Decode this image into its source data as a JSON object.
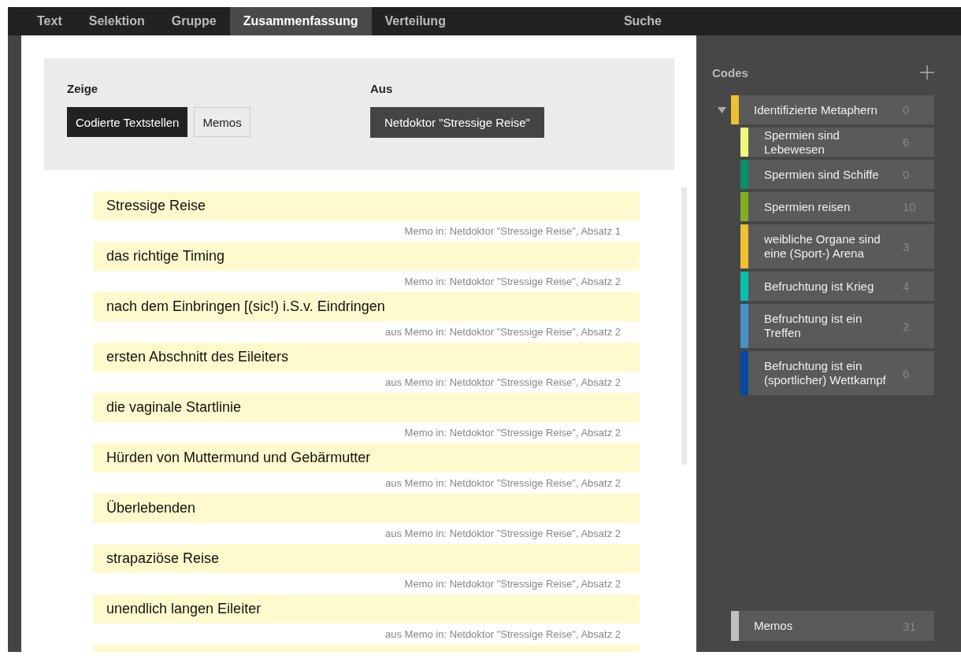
{
  "tabs": [
    {
      "label": "Text",
      "selected": false
    },
    {
      "label": "Selektion",
      "selected": false
    },
    {
      "label": "Gruppe",
      "selected": false
    },
    {
      "label": "Zusammenfassung",
      "selected": true
    },
    {
      "label": "Verteilung",
      "selected": false
    }
  ],
  "search_tab": {
    "label": "Suche"
  },
  "filter": {
    "show_label": "Zeige",
    "show_options": [
      {
        "label": "Codierte Textstellen",
        "selected": true
      },
      {
        "label": "Memos",
        "selected": false
      }
    ],
    "from_label": "Aus",
    "from_document": "Netdoktor \"Stressige Reise\""
  },
  "segments": [
    {
      "text": "Stressige Reise",
      "source": "Memo in: Netdoktor \"Stressige Reise\", Absatz 1"
    },
    {
      "text": "das richtige Timing",
      "source": "Memo in: Netdoktor \"Stressige Reise\", Absatz 2"
    },
    {
      "text": "nach dem Einbringen [(sic!) i.S.v. Eindringen",
      "source": "aus Memo in: Netdoktor \"Stressige Reise\", Absatz 2"
    },
    {
      "text": "ersten Abschnitt des Eileiters",
      "source": "aus Memo in: Netdoktor \"Stressige Reise\", Absatz 2"
    },
    {
      "text": "die vaginale Startlinie",
      "source": "Memo in: Netdoktor \"Stressige Reise\", Absatz 2"
    },
    {
      "text": "Hürden von Muttermund und Gebärmutter",
      "source": "aus Memo in: Netdoktor \"Stressige Reise\", Absatz 2"
    },
    {
      "text": "Überlebenden",
      "source": "aus Memo in: Netdoktor \"Stressige Reise\", Absatz 2"
    },
    {
      "text": "strapaziöse Reise",
      "source": "Memo in: Netdoktor \"Stressige Reise\", Absatz 2"
    },
    {
      "text": "unendlich langen Eileiter",
      "source": "aus Memo in: Netdoktor \"Stressige Reise\", Absatz 2"
    }
  ],
  "codes": {
    "title": "Codes",
    "tree": [
      {
        "label": "Identifizierte Metaphern",
        "count": "0",
        "color": "#f0c030",
        "expanded": true,
        "children": [
          {
            "label": "Spermien sind Lebewesen",
            "count": "6",
            "color": "#f0f878"
          },
          {
            "label": "Spermien sind Schiffe",
            "count": "0",
            "color": "#08906a"
          },
          {
            "label": "Spermien reisen",
            "count": "10",
            "color": "#80b020"
          },
          {
            "label": "weibliche Organe sind eine (Sport-) Arena",
            "count": "3",
            "color": "#f0c030"
          },
          {
            "label": "Befruchtung ist Krieg",
            "count": "4",
            "color": "#08c0b0"
          },
          {
            "label": "Befruchtung ist ein Treffen",
            "count": "2",
            "color": "#4890c8"
          },
          {
            "label": "Befruchtung ist ein (sportlicher) Wettkampf",
            "count": "6",
            "color": "#0848a0"
          }
        ]
      }
    ]
  },
  "memos": {
    "label": "Memos",
    "count": "31",
    "color": "#c0c0c0"
  }
}
